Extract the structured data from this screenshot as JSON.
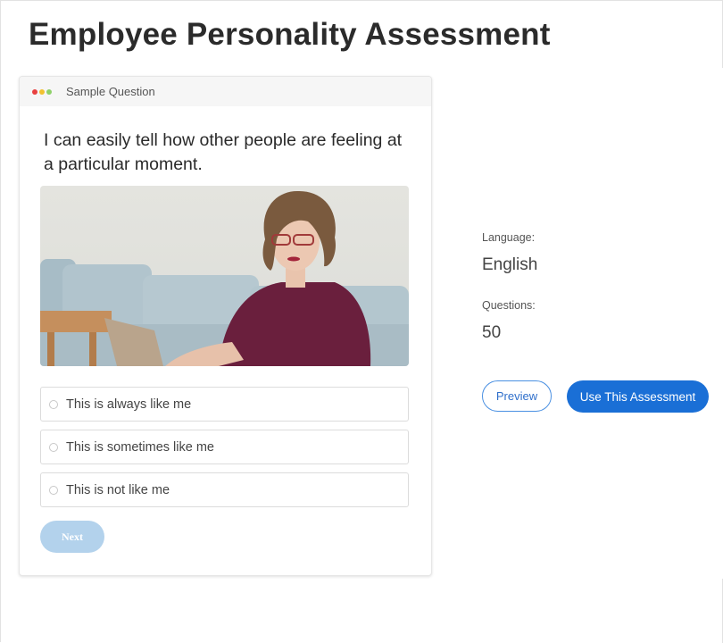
{
  "page": {
    "title": "Employee Personality Assessment"
  },
  "card": {
    "header_title": "Sample Question",
    "window_dots": {
      "red": "#e84040",
      "yellow": "#f2c230",
      "green": "#8fd16a"
    },
    "question": "I can easily tell how other people are feeling at a particular moment.",
    "image_alt": "Woman with curly hair and glasses smiling while using a laptop on a sofa",
    "options": [
      {
        "label": "This is always like me",
        "selected": false
      },
      {
        "label": "This is sometimes like me",
        "selected": false
      },
      {
        "label": "This is not like me",
        "selected": false
      }
    ],
    "next_label": "Next"
  },
  "details": {
    "language_label": "Language:",
    "language_value": "English",
    "questions_label": "Questions:",
    "questions_value": "50"
  },
  "actions": {
    "preview_label": "Preview",
    "use_label": "Use This Assessment"
  },
  "colors": {
    "primary": "#1a6fd6",
    "next_disabled": "#b3d2ec"
  }
}
